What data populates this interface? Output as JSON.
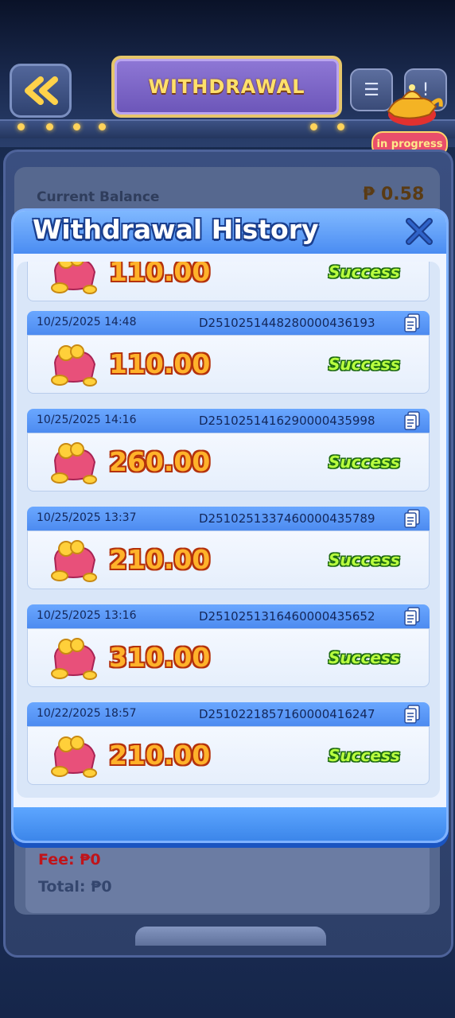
{
  "header": {
    "title": "WITHDRAWAL",
    "in_progress_badge": "in progress"
  },
  "balance": {
    "label": "Current Balance",
    "value": "₱ 0.58"
  },
  "fees": {
    "fee": "Fee: ₱0",
    "total": "Total: ₱0"
  },
  "modal": {
    "title": "Withdrawal History",
    "records": [
      {
        "date": "",
        "id": "",
        "amount": "110.00",
        "status": "Success"
      },
      {
        "date": "10/25/2025 14:48",
        "id": "D2510251448280000436193",
        "amount": "110.00",
        "status": "Success"
      },
      {
        "date": "10/25/2025 14:16",
        "id": "D2510251416290000435998",
        "amount": "260.00",
        "status": "Success"
      },
      {
        "date": "10/25/2025 13:37",
        "id": "D2510251337460000435789",
        "amount": "210.00",
        "status": "Success"
      },
      {
        "date": "10/25/2025 13:16",
        "id": "D2510251316460000435652",
        "amount": "310.00",
        "status": "Success"
      },
      {
        "date": "10/22/2025 18:57",
        "id": "D2510221857160000416247",
        "amount": "210.00",
        "status": "Success"
      }
    ]
  },
  "colors": {
    "accent": "#4a8cf2",
    "success": "#b9ff3f",
    "amount": "#ffb22a",
    "fee_label": "#c0141a"
  }
}
